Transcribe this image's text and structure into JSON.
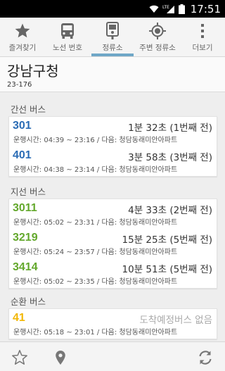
{
  "status_bar": {
    "time": "17:51",
    "network": "LTE"
  },
  "tabs": [
    {
      "label": "즐겨찾기",
      "icon": "star-icon",
      "active": false
    },
    {
      "label": "노선 번호",
      "icon": "bus-icon",
      "active": false
    },
    {
      "label": "정류소",
      "icon": "bus-stop-icon",
      "active": true
    },
    {
      "label": "주변 정류소",
      "icon": "location-target-icon",
      "active": false
    },
    {
      "label": "더보기",
      "icon": "more-vert-icon",
      "active": false
    }
  ],
  "stop": {
    "name": "강남구청",
    "code": "23-176"
  },
  "sections": [
    {
      "label": "간선 버스",
      "color": "#2b6cb5",
      "buses": [
        {
          "number": "301",
          "arrival": "1분 32초 (1번째 전)",
          "detail": "운행시간: 04:39 ~ 23:16 / 다음: 청담동래미안아파트"
        },
        {
          "number": "401",
          "arrival": "3분 58초 (3번째 전)",
          "detail": "운행시간: 04:38 ~ 23:14 / 다음: 청담동래미안아파트"
        }
      ]
    },
    {
      "label": "지선 버스",
      "color": "#63a82c",
      "buses": [
        {
          "number": "3011",
          "arrival": "4분 33초 (2번째 전)",
          "detail": "운행시간: 05:02 ~ 23:31 / 다음: 청담동래미안아파트"
        },
        {
          "number": "3219",
          "arrival": "15분 25초 (5번째 전)",
          "detail": "운행시간: 05:24 ~ 23:57 / 다음: 청담동래미안아파트"
        },
        {
          "number": "3414",
          "arrival": "10분 51초 (5번째 전)",
          "detail": "운행시간: 05:02 ~ 23:35 / 다음: 청담동래미안아파트"
        }
      ]
    },
    {
      "label": "순환 버스",
      "color": "#f2b705",
      "buses": [
        {
          "number": "41",
          "arrival": "도착예정버스 없음",
          "detail": "운행시간: 05:18 ~ 23:01 / 다음: 청담동래미안아파트"
        }
      ]
    }
  ],
  "bottom_bar": {
    "left_icons": [
      "star-outline-icon",
      "location-pin-icon"
    ],
    "right_icon": "refresh-icon"
  },
  "colors": {
    "accent": "#6fa7c7",
    "trunk_bus": "#2b6cb5",
    "branch_bus": "#63a82c",
    "circular_bus": "#f2b705"
  }
}
